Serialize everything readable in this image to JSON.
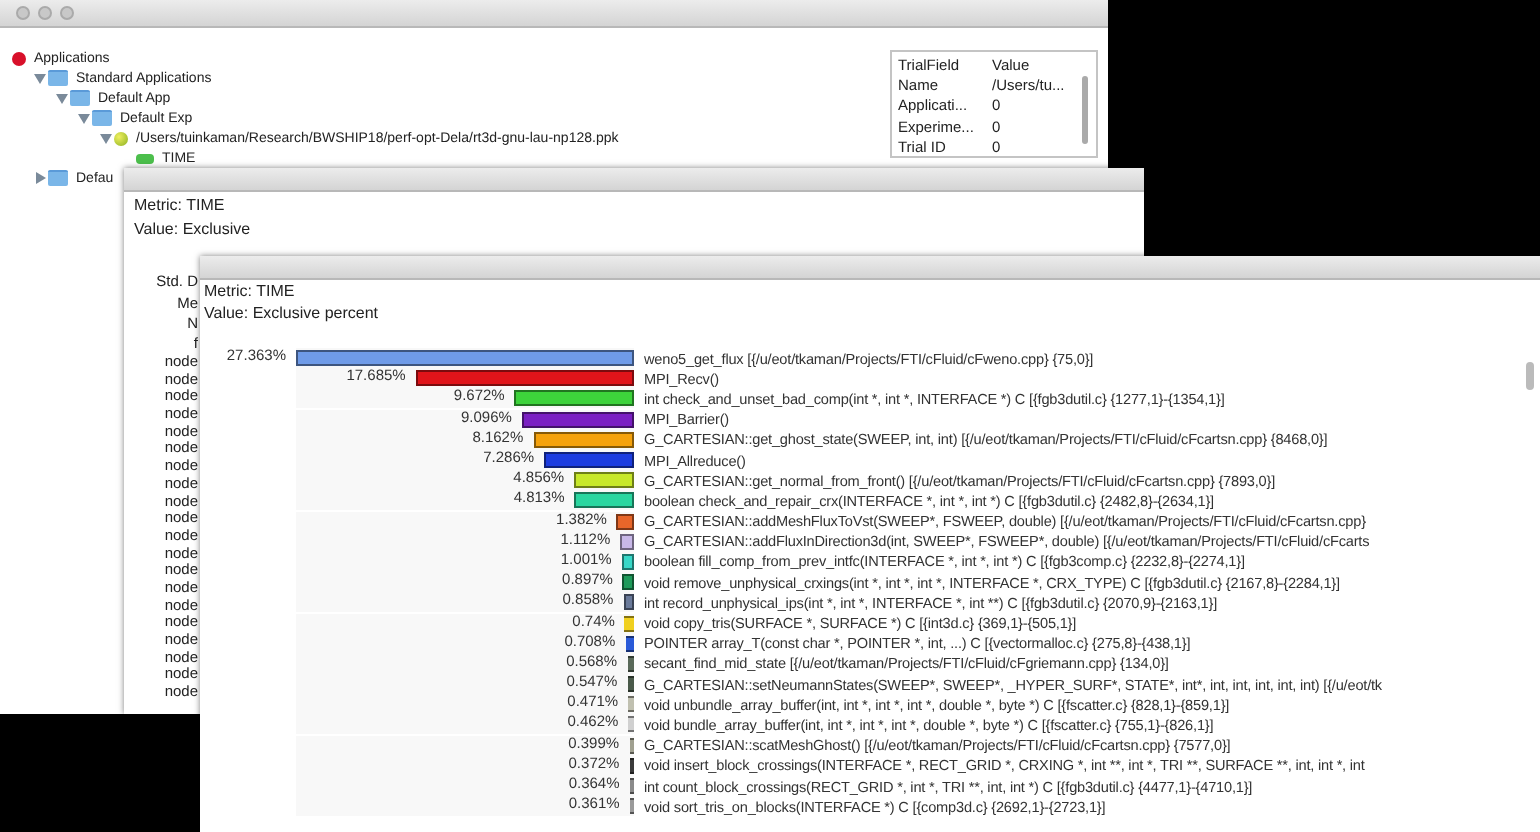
{
  "manager_window": {
    "tree": [
      {
        "label": "Applications",
        "kind": "root",
        "children": [
          {
            "label": "Standard Applications",
            "kind": "folder",
            "expanded": true,
            "children": [
              {
                "label": "Default App",
                "kind": "folder",
                "expanded": true,
                "children": [
                  {
                    "label": "Default Exp",
                    "kind": "folder",
                    "expanded": true,
                    "children": [
                      {
                        "label": "/Users/tuinkaman/Research/BWSHIP18/perf-opt-Dela/rt3d-gnu-lau-np128.ppk",
                        "kind": "trial",
                        "expanded": true,
                        "children": [
                          {
                            "label": "TIME",
                            "kind": "metric"
                          }
                        ]
                      }
                    ]
                  }
                ]
              }
            ]
          },
          {
            "label": "Defau",
            "kind": "folder",
            "expanded": false
          }
        ]
      }
    ],
    "trial_table": {
      "columns": [
        "TrialField",
        "Value"
      ],
      "rows": [
        [
          "Name",
          "/Users/tu..."
        ],
        [
          "Applicati...",
          "0"
        ],
        [
          "Experime...",
          "0"
        ],
        [
          "Trial ID",
          "0"
        ]
      ]
    }
  },
  "exclusive_window": {
    "metric": "Metric: TIME",
    "value": "Value: Exclusive",
    "side_labels": [
      "Std. D",
      "Me",
      "N",
      "f"
    ],
    "rows": [
      "node",
      "node",
      "node",
      "node",
      "node",
      "node",
      "node",
      "node",
      "node",
      "node",
      "node",
      "node",
      "node",
      "node",
      "node",
      "node",
      "node",
      "node",
      "node",
      "node"
    ]
  },
  "percent_window": {
    "metric": "Metric: TIME",
    "value": "Value: Exclusive percent",
    "rows": [
      {
        "value": "27.363%",
        "level": 1,
        "color": "#6f9be8",
        "label": "weno5_get_flux [{/u/eot/tkaman/Projects/FTI/cFluid/cFweno.cpp} {75,0}]"
      },
      {
        "value": "17.685%",
        "level": 0.646,
        "color": "#e0141a",
        "label": "MPI_Recv()"
      },
      {
        "value": "9.672%",
        "level": 0.353,
        "color": "#3dd33b",
        "label": "int check_and_unset_bad_comp(int *, int *, INTERFACE *) C [{fgb3dutil.c} {1277,1}-{1354,1}]"
      },
      {
        "value": "9.096%",
        "level": 0.332,
        "color": "#7a1fc2",
        "label": "MPI_Barrier()"
      },
      {
        "value": "8.162%",
        "level": 0.298,
        "color": "#f5a20d",
        "label": "G_CARTESIAN::get_ghost_state(SWEEP, int, int) [{/u/eot/tkaman/Projects/FTI/cFluid/cFcartsn.cpp} {8468,0}]"
      },
      {
        "value": "7.286%",
        "level": 0.266,
        "color": "#1c3ce0",
        "label": "MPI_Allreduce()"
      },
      {
        "value": "4.856%",
        "level": 0.177,
        "color": "#c8e82a",
        "label": "G_CARTESIAN::get_normal_from_front() [{/u/eot/tkaman/Projects/FTI/cFluid/cFcartsn.cpp} {7893,0}]"
      },
      {
        "value": "4.813%",
        "level": 0.176,
        "color": "#2ad6a0",
        "label": "boolean check_and_repair_crx(INTERFACE *, int *, int *) C [{fgb3dutil.c} {2482,8}-{2634,1}]"
      },
      {
        "value": "1.382%",
        "level": 0.0505,
        "color": "#e8662a",
        "label": "G_CARTESIAN::addMeshFluxToVst(SWEEP*, FSWEEP, double) [{/u/eot/tkaman/Projects/FTI/cFluid/cFcartsn.cpp}"
      },
      {
        "value": "1.112%",
        "level": 0.0406,
        "color": "#c8b8e8",
        "label": "G_CARTESIAN::addFluxInDirection3d(int, SWEEP*, FSWEEP*, double) [{/u/eot/tkaman/Projects/FTI/cFluid/cFcarts"
      },
      {
        "value": "1.001%",
        "level": 0.0366,
        "color": "#38d8c8",
        "label": "boolean fill_comp_from_prev_intfc(INTERFACE *, int *, int *) C [{fgb3comp.c} {2232,8}-{2274,1}]"
      },
      {
        "value": "0.897%",
        "level": 0.0328,
        "color": "#1e9a5a",
        "label": "void remove_unphysical_crxings(int *, int *, int *, INTERFACE *, CRX_TYPE) C [{fgb3dutil.c} {2167,8}-{2284,1}]"
      },
      {
        "value": "0.858%",
        "level": 0.0314,
        "color": "#6a7a9a",
        "label": "int record_unphysical_ips(int *, int *, INTERFACE *, int **) C [{fgb3dutil.c} {2070,9}-{2163,1}]"
      },
      {
        "value": "0.74%",
        "level": 0.027,
        "color": "#f0d020",
        "label": "void copy_tris(SURFACE *, SURFACE *) C [{int3d.c} {369,1}-{505,1}]"
      },
      {
        "value": "0.708%",
        "level": 0.0259,
        "color": "#2a5ad8",
        "label": "POINTER array_T(const char *, POINTER *, int, ...) C [{vectormalloc.c} {275,8}-{438,1}]"
      },
      {
        "value": "0.568%",
        "level": 0.0208,
        "color": "#5a6a5a",
        "label": "secant_find_mid_state [{/u/eot/tkaman/Projects/FTI/cFluid/cFgriemann.cpp} {134,0}]"
      },
      {
        "value": "0.547%",
        "level": 0.02,
        "color": "#4a5a4a",
        "label": "G_CARTESIAN::setNeumannStates(SWEEP*, SWEEP*, _HYPER_SURF*, STATE*, int*, int, int, int, int, int) [{/u/eot/tk"
      },
      {
        "value": "0.471%",
        "level": 0.0172,
        "color": "#c0c0b0",
        "label": "void unbundle_array_buffer(int, int *, int *, int *, double *, byte *) C [{fscatter.c} {828,1}-{859,1}]"
      },
      {
        "value": "0.462%",
        "level": 0.0169,
        "color": "#d0d0d0",
        "label": "void bundle_array_buffer(int, int *, int *, int *, double *, byte *) C [{fscatter.c} {755,1}-{826,1}]"
      },
      {
        "value": "0.399%",
        "level": 0.0146,
        "color": "#a0a090",
        "label": "G_CARTESIAN::scatMeshGhost() [{/u/eot/tkaman/Projects/FTI/cFluid/cFcartsn.cpp} {7577,0}]"
      },
      {
        "value": "0.372%",
        "level": 0.0136,
        "color": "#3a3a3a",
        "label": "void insert_block_crossings(INTERFACE *, RECT_GRID *, CRXING *, int **, int *, TRI **, SURFACE **, int, int *, int"
      },
      {
        "value": "0.364%",
        "level": 0.0133,
        "color": "#8a8a8a",
        "label": "int count_block_crossings(RECT_GRID *, int *, TRI **, int, int *) C [{fgb3dutil.c} {4477,1}-{4710,1}]"
      },
      {
        "value": "0.361%",
        "level": 0.0132,
        "color": "#9a9a9a",
        "label": "void sort_tris_on_blocks(INTERFACE *) C [{comp3d.c} {2692,1}-{2723,1}]"
      }
    ]
  }
}
